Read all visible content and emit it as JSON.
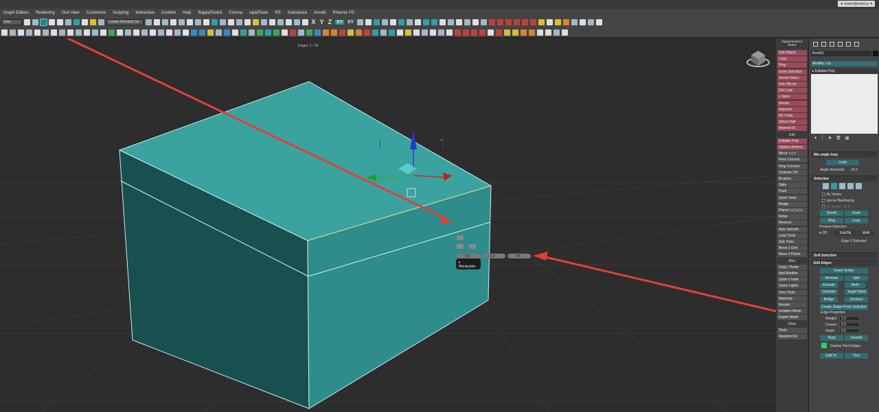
{
  "menu": [
    "Graph Editors",
    "Rendering",
    "Civil View",
    "Customize",
    "Scripting",
    "Interactive",
    "Content",
    "Help",
    "RappaTools3",
    "Corona",
    "rapidTools",
    "RS",
    "Substance",
    "Arnold",
    "Phoenix FD"
  ],
  "account": "rustm@mail.ru",
  "toolbar": {
    "view_dropdown": "View",
    "selection_set_dropdown": "Create Selection Se",
    "axes": [
      "X",
      "Y",
      "Z",
      "XY",
      "XY"
    ]
  },
  "viewport": {
    "status": "Edges: 1 / 20",
    "caddy": {
      "title": "Manipulate",
      "values": [
        "0.0",
        "1.0",
        "0.5"
      ]
    }
  },
  "rappa": {
    "title": "RappaTools3.5",
    "subtitle": "Select",
    "items": [
      {
        "label": "Sub Object",
        "style": "pink"
      },
      {
        "label": "Loop",
        "style": "pink"
      },
      {
        "label": "Ring",
        "style": "pink"
      },
      {
        "label": "Grow Selection",
        "style": "pink"
      },
      {
        "label": "Shrink Select",
        "style": "pink"
      },
      {
        "label": "Sub Obj Iso",
        "style": "pink"
      },
      {
        "label": "Dot Loop",
        "style": "pink"
      },
      {
        "label": "+ Save",
        "style": "pink"
      },
      {
        "label": "Similar",
        "style": "pink"
      },
      {
        "label": "Adjacent",
        "style": "pink"
      },
      {
        "label": "Fill / Hole",
        "style": "pink"
      },
      {
        "label": "Select Half",
        "style": "pink"
      },
      {
        "label": "Material ID",
        "style": "pink"
      },
      {
        "label": "Edit",
        "style": "hdr"
      },
      {
        "label": "Editable Poly",
        "style": "pink"
      },
      {
        "label": "Objects Actions",
        "style": "pink"
      },
      {
        "label": "Mirror  x  y  z",
        "style": "plain"
      },
      {
        "label": "Flow Connect",
        "style": "plain"
      },
      {
        "label": "Ring Connect",
        "style": "plain"
      },
      {
        "label": "Chamfer OP",
        "style": "plain"
      },
      {
        "label": "Brushes",
        "style": "plain"
      },
      {
        "label": "Slide",
        "style": "plain"
      },
      {
        "label": "Push",
        "style": "plain"
      },
      {
        "label": "Quick Tools",
        "style": "plain"
      },
      {
        "label": "Bridge",
        "style": "plain"
      },
      {
        "label": "Planar | x | y | z",
        "style": "plain"
      },
      {
        "label": "Relax",
        "style": "plain"
      },
      {
        "label": "Remove",
        "style": "plain"
      },
      {
        "label": "Auto Smooth",
        "style": "plain"
      },
      {
        "label": "Loop Tools",
        "style": "plain"
      },
      {
        "label": "Sub Tools",
        "style": "plain"
      },
      {
        "label": "Move 2 Grid",
        "style": "plain"
      },
      {
        "label": "Move 2 Points",
        "style": "plain"
      },
      {
        "label": "Misc",
        "style": "hdr"
      },
      {
        "label": "Copy / Paste",
        "style": "plain"
      },
      {
        "label": "Add Modifier",
        "style": "plain"
      },
      {
        "label": "Quick Create",
        "style": "plain"
      },
      {
        "label": "Came Lights",
        "style": "plain"
      },
      {
        "label": "View Tools",
        "style": "plain"
      },
      {
        "label": "Materials",
        "style": "plain"
      },
      {
        "label": "Render",
        "style": "plain"
      },
      {
        "label": "Isolation Mode",
        "style": "plain"
      },
      {
        "label": "Expert Mode",
        "style": "plain"
      },
      {
        "label": "Other",
        "style": "hdr"
      },
      {
        "label": "Tools",
        "style": "plain"
      },
      {
        "label": "Random Fix",
        "style": "plain"
      }
    ]
  },
  "command_panel": {
    "object_name": "Box001",
    "modifier_list": "Modifier List",
    "stack_item": "Editable Poly",
    "min_angle_loop": {
      "header": "Min angle loop",
      "loop_button": "Loop",
      "angle_label": "Angle threshold:",
      "angle_value": "25.0"
    },
    "selection": {
      "header": "Selection",
      "by_vertex": "By Vertex",
      "ignore_backfacing": "Ignore Backfacing",
      "by_angle": "By Angle:",
      "by_angle_value": "45.0",
      "shrink": "Shrink",
      "grow": "Grow",
      "ring": "Ring",
      "loop": "Loop",
      "preview_label": "Preview Selection",
      "preview_off": "Off",
      "preview_subobj": "SubObj",
      "preview_multi": "Multi",
      "status": "Edge 5 Selected"
    },
    "soft_selection": {
      "header": "Soft Selection"
    },
    "edit_edges": {
      "header": "Edit Edges",
      "insert_vertex": "Insert Vertex",
      "remove": "Remove",
      "split": "Split",
      "extrude": "Extrude",
      "weld": "Weld",
      "chamfer": "Chamfer",
      "target_weld": "Target Weld",
      "bridge": "Bridge",
      "connect": "Connect",
      "create_shape": "Create Shape From Selection",
      "edge_props": "Edge Properties",
      "weight_label": "Weight:",
      "weight_value": "1.0",
      "crease_label": "Crease:",
      "crease_value": "0.0",
      "depth_label": "Depth:",
      "depth_value": "0.5",
      "hard": "Hard",
      "smooth": "Smooth",
      "display_hard": "Display Hard Edges",
      "edit_tri": "Edit Tri.",
      "turn": "Turn"
    }
  },
  "colors": {
    "box_top": "#3aa39f",
    "box_front": "#2e8c8a",
    "box_side": "#18504f",
    "annotation": "#e2403a",
    "accent": "#2f6f73"
  }
}
